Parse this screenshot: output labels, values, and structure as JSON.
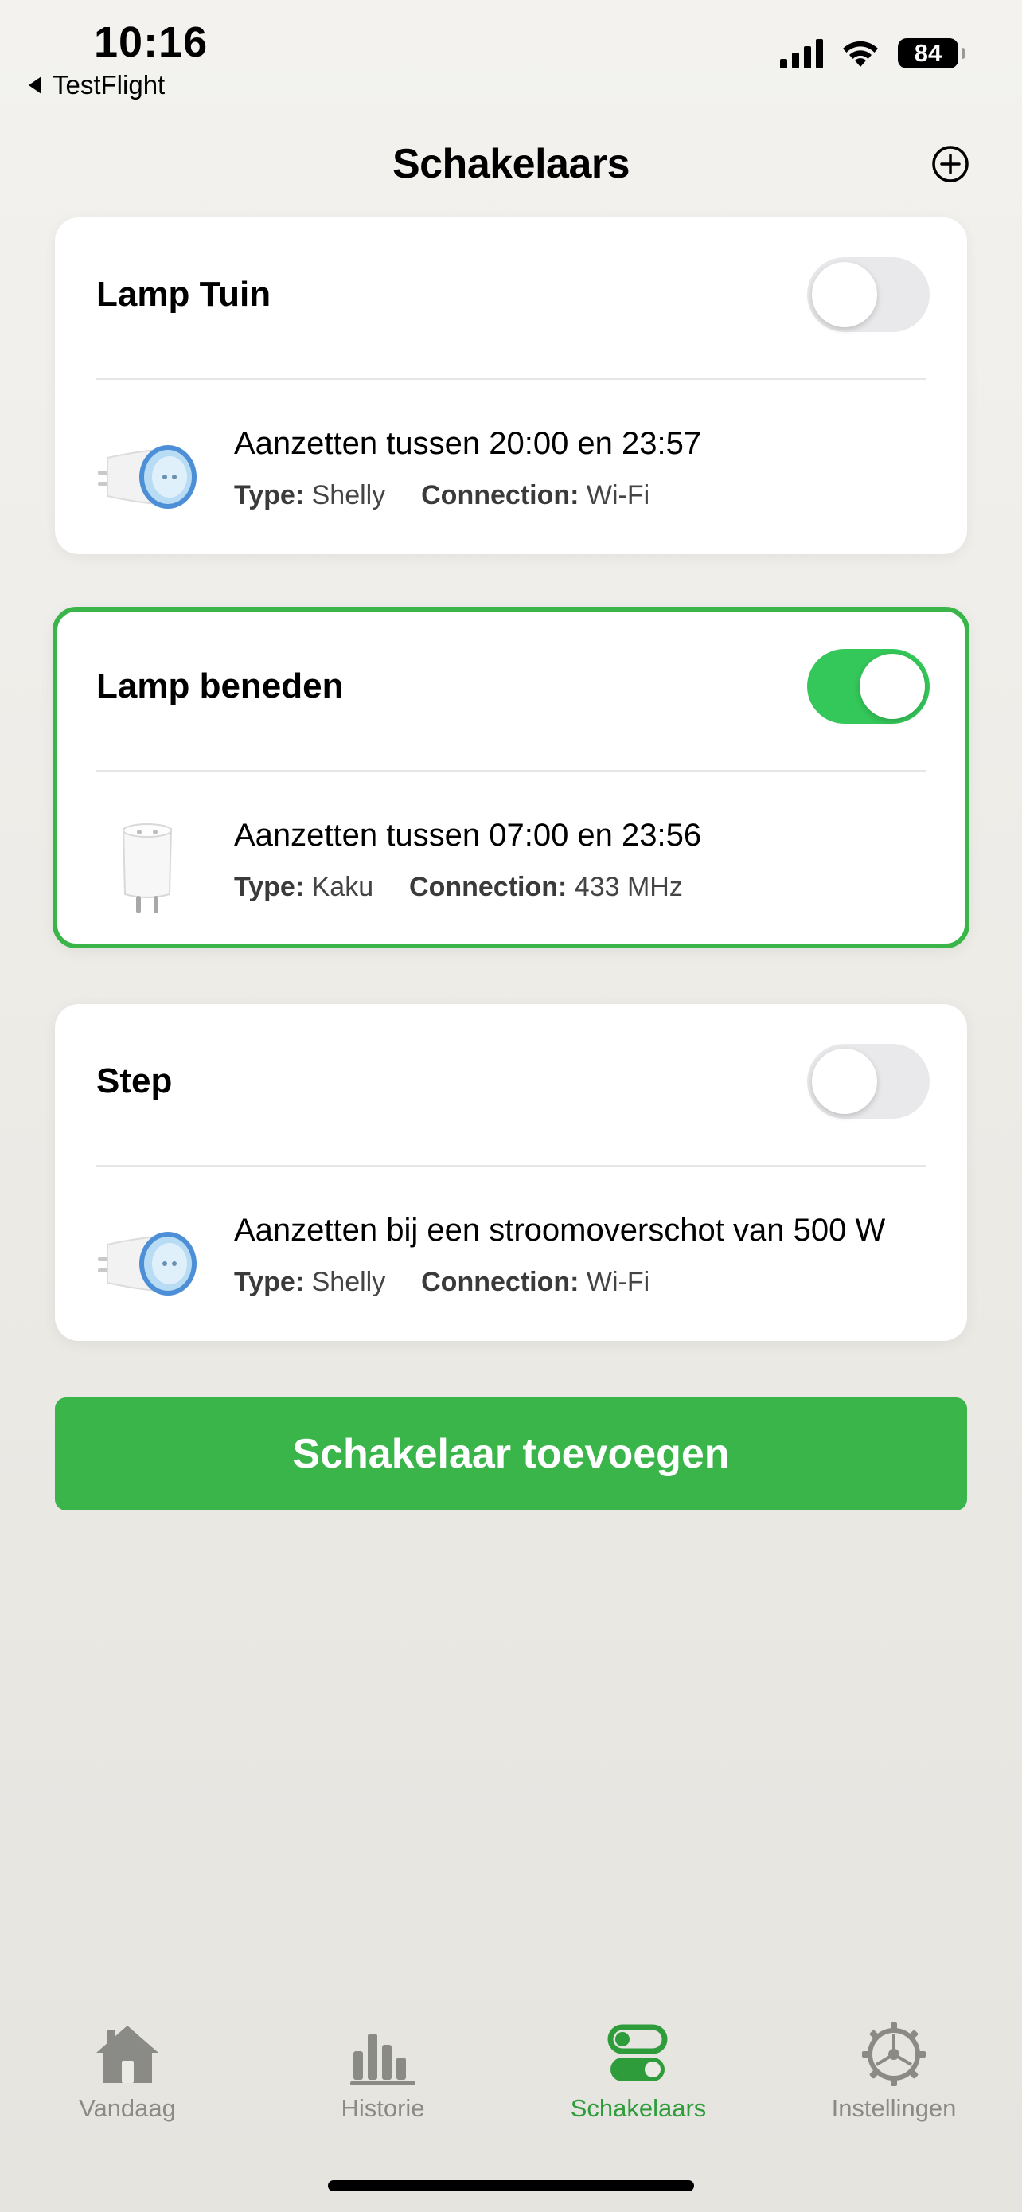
{
  "status_bar": {
    "time": "10:16",
    "back_app": "TestFlight",
    "battery": "84"
  },
  "header": {
    "title": "Schakelaars"
  },
  "switches": [
    {
      "name": "Lamp Tuin",
      "on": false,
      "schedule": "Aanzetten tussen 20:00 en 23:57",
      "type_label": "Type:",
      "type": "Shelly",
      "connection_label": "Connection:",
      "connection": "Wi-Fi",
      "device_icon": "shelly-plug-icon"
    },
    {
      "name": "Lamp beneden",
      "on": true,
      "schedule": "Aanzetten tussen 07:00 en 23:56",
      "type_label": "Type:",
      "type": "Kaku",
      "connection_label": "Connection:",
      "connection": "433 MHz",
      "device_icon": "kaku-plug-icon"
    },
    {
      "name": "Step",
      "on": false,
      "schedule": "Aanzetten bij een stroomoverschot van 500 W",
      "type_label": "Type:",
      "type": "Shelly",
      "connection_label": "Connection:",
      "connection": "Wi-Fi",
      "device_icon": "shelly-plug-icon"
    }
  ],
  "add_button": {
    "label": "Schakelaar toevoegen"
  },
  "tabs": [
    {
      "label": "Vandaag",
      "icon": "home-icon",
      "selected": false
    },
    {
      "label": "Historie",
      "icon": "bar-chart-icon",
      "selected": false
    },
    {
      "label": "Schakelaars",
      "icon": "toggles-icon",
      "selected": true
    },
    {
      "label": "Instellingen",
      "icon": "gear-icon",
      "selected": false
    }
  ],
  "colors": {
    "accent_green": "#3ab54a",
    "toggle_on": "#34c759",
    "toggle_off": "#e9e9eb",
    "tab_inactive": "#8a8a86",
    "tab_active": "#2e9c3b"
  }
}
